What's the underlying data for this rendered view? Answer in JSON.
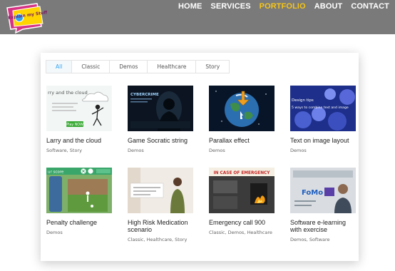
{
  "logo": {
    "text": "Explain my Stuff"
  },
  "nav": {
    "items": [
      "HOME",
      "SERVICES",
      "PORTFOLIO",
      "ABOUT",
      "CONTACT"
    ],
    "active": "PORTFOLIO",
    "active_color": "#f5c518",
    "bar_color": "#7a7a7a"
  },
  "filters": [
    "All",
    "Classic",
    "Demos",
    "Healthcare",
    "Story"
  ],
  "active_filter": "All",
  "accent_color": "#2ea3f2",
  "projects": [
    {
      "title": "Larry and the cloud",
      "tags": "Software, Story",
      "thumb_text": "rry and the cloud",
      "thumb_button": "Play NOW"
    },
    {
      "title": "Game Socratic string",
      "tags": "Demos",
      "thumb_text": "CYBERCRIME"
    },
    {
      "title": "Parallax effect",
      "tags": "Demos"
    },
    {
      "title": "Text on image layout",
      "tags": "Demos",
      "thumb_text": "Design tips",
      "thumb_text2": "5 ways to combine text and image"
    },
    {
      "title": "Penalty challenge",
      "tags": "Demos",
      "thumb_text": "ur score"
    },
    {
      "title": "High Risk Medication scenario",
      "tags": "Classic, Healthcare, Story"
    },
    {
      "title": "Emergency call 900",
      "tags": "Classic, Demos, Healthcare",
      "thumb_text": "IN CASE OF EMERGENCY"
    },
    {
      "title": "Software e-learning with exercise",
      "tags": "Demos, Software",
      "thumb_text": "FoMo"
    }
  ]
}
